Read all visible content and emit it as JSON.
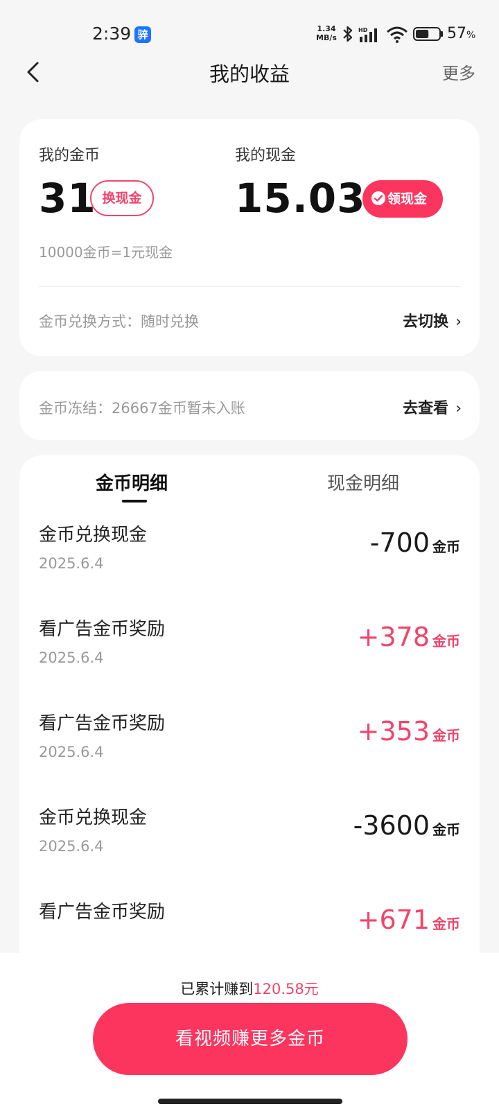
{
  "status_bar": {
    "time": "2:39",
    "app_icon_glyph": "骍",
    "net_speed_value": "1.34",
    "net_speed_unit": "MB/s",
    "signal_label": "HD",
    "battery_value": "57",
    "battery_unit": "%"
  },
  "nav": {
    "title": "我的收益",
    "more": "更多"
  },
  "balance": {
    "coin_label": "我的金币",
    "coin_value": "31",
    "exchange_button": "换现金",
    "cash_label": "我的现金",
    "cash_value": "15.03",
    "claim_button": "领现金",
    "rate": "10000金币=1元现金",
    "mode": "金币兑换方式：随时兑换",
    "switch_link": "去切换"
  },
  "frozen": {
    "text": "金币冻结：26667金币暂未入账",
    "link": "去查看"
  },
  "tabs": [
    {
      "label": "金币明细",
      "active": true
    },
    {
      "label": "现金明细",
      "active": false
    }
  ],
  "records": [
    {
      "title": "金币兑换现金",
      "date": "2025.6.4",
      "amount": "-700",
      "unit": "金币",
      "positive": false
    },
    {
      "title": "看广告金币奖励",
      "date": "2025.6.4",
      "amount": "+378",
      "unit": "金币",
      "positive": true
    },
    {
      "title": "看广告金币奖励",
      "date": "2025.6.4",
      "amount": "+353",
      "unit": "金币",
      "positive": true
    },
    {
      "title": "金币兑换现金",
      "date": "2025.6.4",
      "amount": "-3600",
      "unit": "金币",
      "positive": false
    },
    {
      "title": "看广告金币奖励",
      "date": "",
      "amount": "+671",
      "unit": "金币",
      "positive": true
    }
  ],
  "footer": {
    "earned_prefix": "已累计赚到",
    "earned_amount": "120.58元",
    "cta": "看视频赚更多金币"
  },
  "colors": {
    "accent": "#fc355f",
    "positive_text": "#f2446c"
  }
}
